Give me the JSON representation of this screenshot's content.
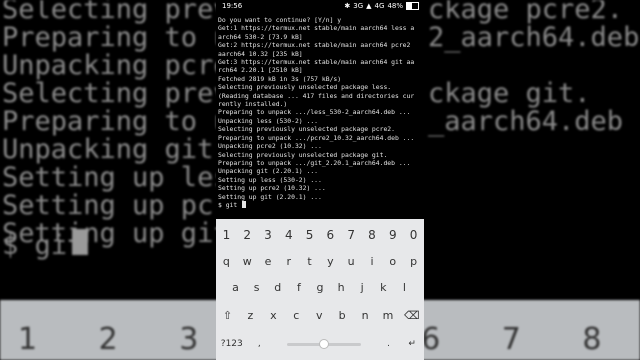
{
  "background": {
    "lines": [
      "Selecting previous",
      "Preparing to unpac",
      "Unpacking pcre2 (",
      "Selecting previous",
      "Preparing to unpac",
      "Unpacking git (2.",
      "Setting up less (",
      "Setting up pcre2",
      "Setting up git (2",
      "$ git"
    ],
    "right_fragments": [
      "ckage pcre2.",
      "2_aarch64.deb .",
      "",
      "ckage git.",
      "_aarch64.deb ..."
    ],
    "keyboard_digits": "1 2 3 4 5 6 7 8 9"
  },
  "status_bar": {
    "time": "19:56",
    "network": "3G",
    "network2": "4G",
    "battery": "48%",
    "battery_level": 0.48
  },
  "terminal": {
    "lines": [
      "Do you want to continue? [Y/n] y",
      "Get:1 https://termux.net stable/main aarch64 less a",
      "arch64 530-2 [73.9 kB]",
      "Get:2 https://termux.net stable/main aarch64 pcre2",
      "aarch64 10.32 [235 kB]",
      "Get:3 https://termux.net stable/main aarch64 git aa",
      "rch64 2.20.1 [2510 kB]",
      "Fetched 2819 kB in 3s (757 kB/s)",
      "Selecting previously unselected package less.",
      "(Reading database ... 417 files and directories cur",
      "rently installed.)",
      "Preparing to unpack .../less_530-2_aarch64.deb ...",
      "Unpacking less (530-2) ...",
      "Selecting previously unselected package pcre2.",
      "Preparing to unpack .../pcre2_10.32_aarch64.deb ...",
      "Unpacking pcre2 (10.32) ...",
      "Selecting previously unselected package git.",
      "Preparing to unpack .../git_2.20.1_aarch64.deb ...",
      "Unpacking git (2.20.1) ...",
      "Setting up less (530-2) ...",
      "Setting up pcre2 (10.32) ...",
      "Setting up git (2.20.1) ..."
    ],
    "prompt": "$ git "
  },
  "keyboard": {
    "numbers": [
      "1",
      "2",
      "3",
      "4",
      "5",
      "6",
      "7",
      "8",
      "9",
      "0"
    ],
    "row1": [
      "q",
      "w",
      "e",
      "r",
      "t",
      "y",
      "u",
      "i",
      "o",
      "p"
    ],
    "row2": [
      "a",
      "s",
      "d",
      "f",
      "g",
      "h",
      "j",
      "k",
      "l"
    ],
    "row3": [
      "z",
      "x",
      "c",
      "v",
      "b",
      "n",
      "m"
    ],
    "symbols_key": "?123",
    "comma_key": ",",
    "period_key": "."
  }
}
